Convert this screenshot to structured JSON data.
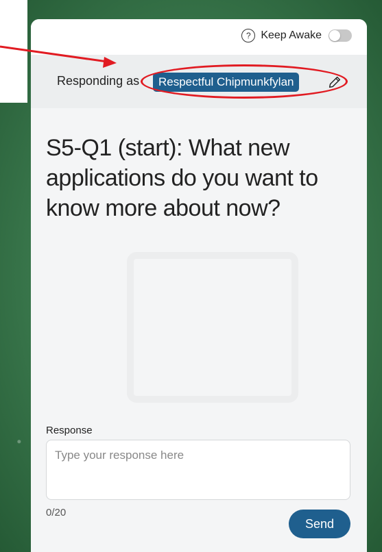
{
  "header": {
    "keep_awake_label": "Keep Awake",
    "help_icon": "question-circle-icon",
    "keep_awake_on": false
  },
  "responding": {
    "label": "Responding as",
    "name": "Respectful Chipmunkfylan",
    "edit_icon": "pencil-icon"
  },
  "question": {
    "text": "S5-Q1 (start): What new applications do you want to know more about now?"
  },
  "response": {
    "label": "Response",
    "placeholder": "Type your response here",
    "value": "",
    "count": "0/20",
    "send_label": "Send"
  },
  "colors": {
    "accent": "#1f5f8e",
    "annotation": "#e11b22"
  }
}
